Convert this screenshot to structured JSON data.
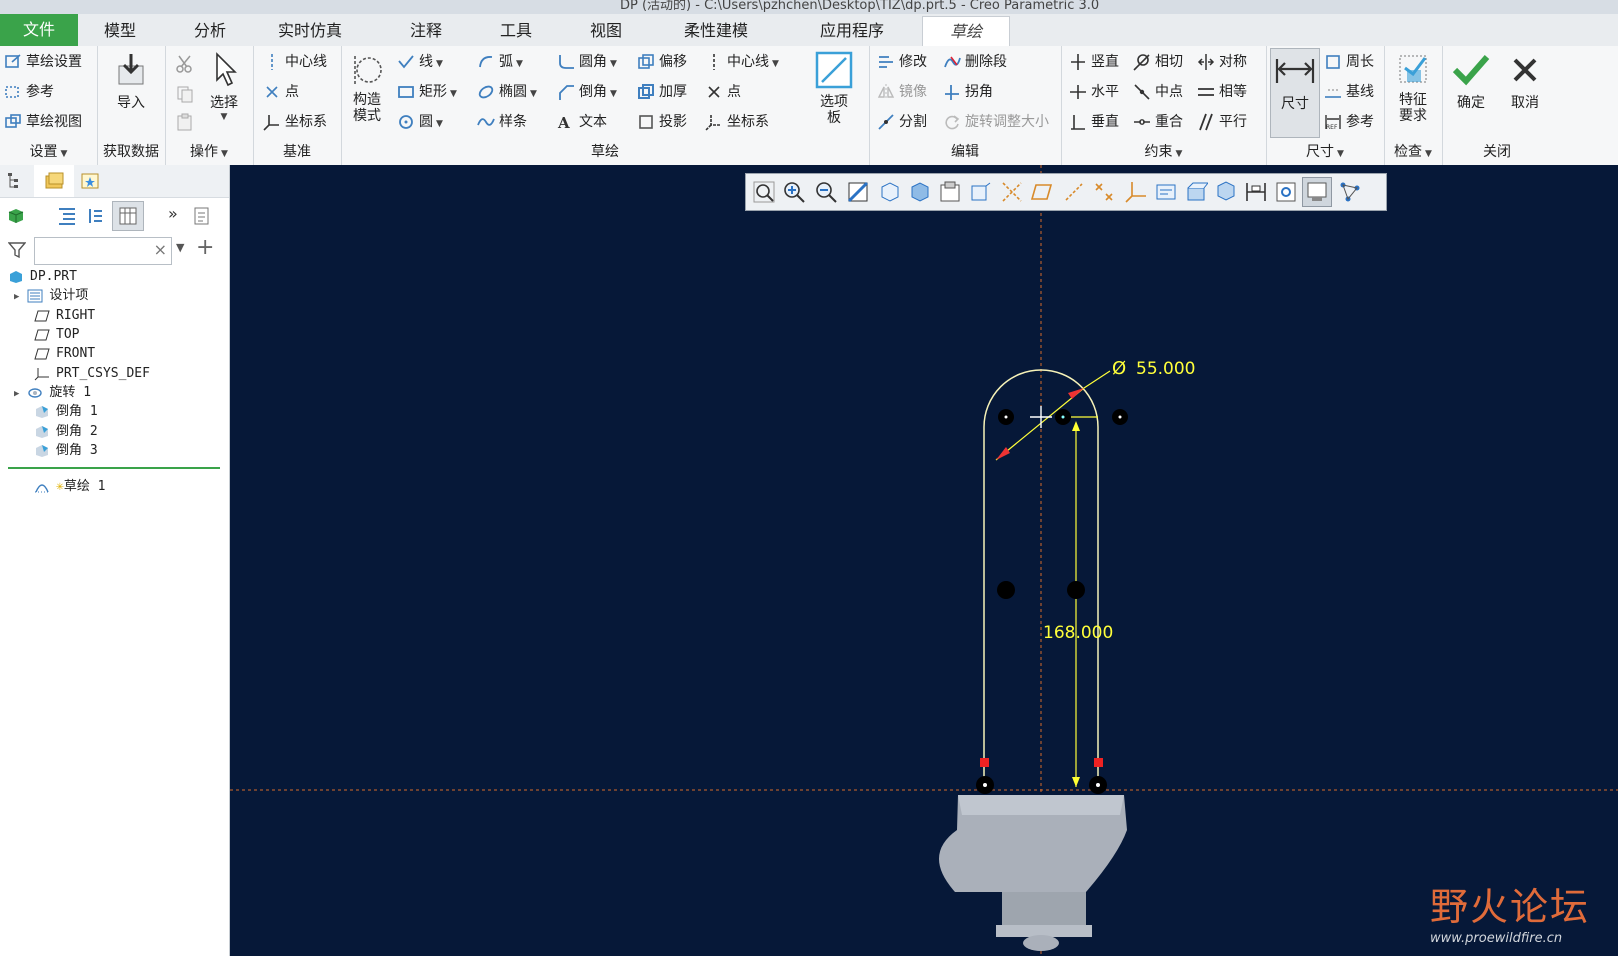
{
  "window": {
    "title": "DP (活动的) - C:\\Users\\pzhchen\\Desktop\\TIZ\\dp.prt.5 - Creo Parametric 3.0"
  },
  "menubar": {
    "tabs": [
      "文件",
      "模型",
      "分析",
      "实时仿真",
      "注释",
      "工具",
      "视图",
      "柔性建模",
      "应用程序",
      "草绘"
    ],
    "active": "草绘"
  },
  "ribbon": {
    "setup": {
      "label": "设置",
      "items": [
        "草绘设置",
        "参考",
        "草绘视图"
      ]
    },
    "getdata": {
      "label": "获取数据",
      "import": "导入"
    },
    "operations": {
      "label": "操作",
      "select": "选择"
    },
    "datum": {
      "label": "基准",
      "items": [
        "中心线",
        "点",
        "坐标系"
      ]
    },
    "sketching": {
      "label": "草绘",
      "construction": "构造\n模式",
      "col1": [
        "线",
        "矩形",
        "圆"
      ],
      "col2": [
        "弧",
        "椭圆",
        "样条"
      ],
      "col3": [
        "圆角",
        "倒角",
        "文本"
      ],
      "col4": [
        "偏移",
        "加厚",
        "投影"
      ],
      "col5": [
        "中心线",
        "点",
        "坐标系"
      ],
      "palette": "选项\n板"
    },
    "editing": {
      "label": "编辑",
      "col1": [
        "修改",
        "镜像",
        "分割"
      ],
      "col2": [
        "删除段",
        "拐角",
        "旋转调整大小"
      ]
    },
    "constrain": {
      "label": "约束",
      "col1": [
        "竖直",
        "水平",
        "垂直"
      ],
      "col2": [
        "相切",
        "中点",
        "重合"
      ],
      "col3": [
        "对称",
        "相等",
        "平行"
      ]
    },
    "dimension": {
      "label": "尺寸",
      "dim": "尺寸",
      "items": [
        "周长",
        "基线",
        "参考"
      ]
    },
    "inspect": {
      "label": "检查",
      "feature": "特征\n要求"
    },
    "close": {
      "label": "关闭",
      "ok": "确定",
      "cancel": "取消"
    }
  },
  "tree": {
    "items": [
      "DP.PRT",
      "设计项",
      "RIGHT",
      "TOP",
      "FRONT",
      "PRT_CSYS_DEF",
      "旋转 1",
      "倒角 1",
      "倒角 2",
      "倒角 3"
    ],
    "insert": "草绘 1"
  },
  "sketch": {
    "diameter": "55.000",
    "height": "168.000"
  },
  "watermark": {
    "cn": "野火论坛",
    "url": "www.proewildfire.cn"
  },
  "colors": {
    "canvas": "#061838",
    "sketch": "#f6f2b8",
    "dim": "#ffff3a",
    "accent": "#3aa34a"
  }
}
